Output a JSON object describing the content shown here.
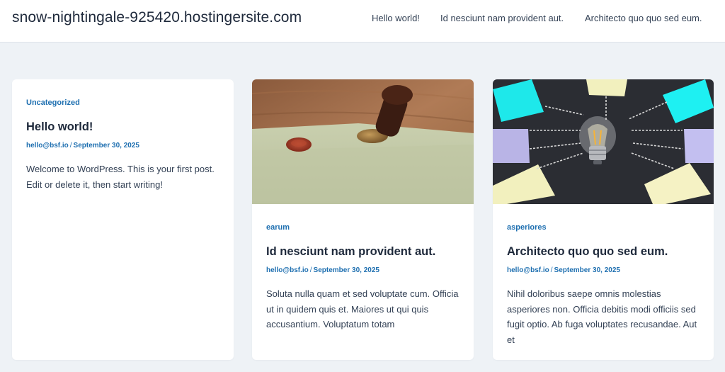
{
  "header": {
    "site_title": "snow-nightingale-925420.hostingersite.com",
    "nav": [
      {
        "label": "Hello world!"
      },
      {
        "label": "Id nesciunt nam provident aut."
      },
      {
        "label": "Architecto quo quo sed eum."
      }
    ]
  },
  "posts": [
    {
      "category": "Uncategorized",
      "title": "Hello world!",
      "author": "hello@bsf.io",
      "separator": "/",
      "date": "September 30, 2025",
      "excerpt": "Welcome to WordPress. This is your first post. Edit or delete it, then start writing!"
    },
    {
      "category": "earum",
      "title": "Id nesciunt nam provident aut.",
      "author": "hello@bsf.io",
      "separator": "/",
      "date": "September 30, 2025",
      "excerpt": "Soluta nulla quam et sed voluptate cum. Officia ut in quidem quis et. Maiores ut qui quis accusantium. Voluptatum totam"
    },
    {
      "category": "asperiores",
      "title": "Architecto quo quo sed eum.",
      "author": "hello@bsf.io",
      "separator": "/",
      "date": "September 30, 2025",
      "excerpt": "Nihil doloribus saepe omnis molestias asperiores non. Officia debitis modi officiis sed fugit optio. Ab fuga voluptates recusandae. Aut et"
    }
  ],
  "colors": {
    "accent": "#1e6fb0",
    "background": "#eef2f6",
    "card": "#ffffff",
    "title": "#1e293b"
  }
}
